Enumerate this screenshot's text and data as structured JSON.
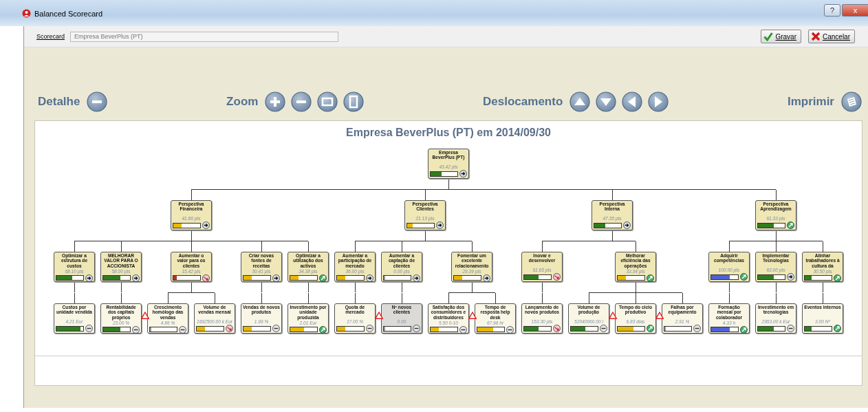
{
  "window": {
    "title": "Balanced Scorecard",
    "controls": [
      {
        "label": "?",
        "kind": "help"
      },
      {
        "label": "x",
        "kind": "close"
      }
    ]
  },
  "header": {
    "label": "Scorecard",
    "value": "Empresa BeverPlus (PT)",
    "actions": [
      {
        "label": "Gravar",
        "kind": "save"
      },
      {
        "label": "Cancelar",
        "kind": "cancel"
      }
    ]
  },
  "toolbar": [
    {
      "label": "Detalhe",
      "tools": [
        {
          "kind": "collapse"
        }
      ]
    },
    {
      "label": "Zoom",
      "tools": [
        {
          "kind": "zoom-in"
        },
        {
          "kind": "zoom-out"
        },
        {
          "kind": "fit-width"
        },
        {
          "kind": "fit-height"
        }
      ]
    },
    {
      "label": "Deslocamento",
      "tools": [
        {
          "kind": "up"
        },
        {
          "kind": "down"
        },
        {
          "kind": "left"
        },
        {
          "kind": "right"
        }
      ]
    },
    {
      "label": "Imprimir",
      "tools": [
        {
          "kind": "print"
        }
      ]
    }
  ],
  "map": {
    "title": "Empresa BeverPlus (PT) em 2014/09/30",
    "root": {
      "title": "Empresa BeverPlus (PT)",
      "value": "43.42 pts",
      "level": 0.4,
      "color": "#2f7d1e",
      "kind": "right",
      "warning": false,
      "disabled": false,
      "children": [
        {
          "title": "Perspectiva Financeira",
          "value": "41.86 pts",
          "level": 0.3,
          "color": "#e8b800",
          "kind": "right",
          "warning": false,
          "disabled": false,
          "children": [
            {
              "title": "Optimizar a estrutura de custos",
              "value": "68.10 pts",
              "level": 0.6,
              "color": "#2f7d1e",
              "kind": "right",
              "warning": false,
              "disabled": false,
              "children": [
                {
                  "title": "Custos por unidade vendida",
                  "value": "4.21 Eur",
                  "level": 0.9,
                  "color": "#2f7d1e",
                  "kind": "none",
                  "warning": false,
                  "disabled": false
                }
              ]
            },
            {
              "title": "MELHORAR VALOR PARA O ACCIONISTA",
              "value": "58.00 pts",
              "level": 0.65,
              "color": "#2f7d1e",
              "kind": "right",
              "warning": false,
              "disabled": false,
              "children": [
                {
                  "title": "Rentabilidade dos capitais próprios",
                  "value": "23.00 %",
                  "level": 0.65,
                  "color": "#2f7d1e",
                  "kind": "none",
                  "warning": false,
                  "disabled": false
                }
              ]
            },
            {
              "title": "Aumentar o valor para os clientes",
              "value": "15.42 pts",
              "level": 0.12,
              "color": "#b8341c",
              "kind": "down",
              "warning": false,
              "disabled": false,
              "children": [
                {
                  "title": "Crescimento homólogo das vendas",
                  "value": "4.86 %",
                  "level": 0,
                  "color": "#9a9a9a",
                  "kind": "none",
                  "warning": true,
                  "disabled": false
                },
                {
                  "title": "Volume de vendas mensal",
                  "value": "1692500.00 k Eur",
                  "level": 0.3,
                  "color": "#e8b800",
                  "kind": "down",
                  "warning": false,
                  "disabled": false
                }
              ]
            },
            {
              "title": "Criar novas fontes de receitas",
              "value": "30.41 pts",
              "level": 0.3,
              "color": "#e8b800",
              "kind": "right",
              "warning": false,
              "disabled": false,
              "children": [
                {
                  "title": "Vendas de novos produtos",
                  "value": "1.99 %",
                  "level": 0.3,
                  "color": "#e8b800",
                  "kind": "none",
                  "warning": false,
                  "disabled": false
                }
              ]
            },
            {
              "title": "Optimizar a utilização dos activos",
              "value": "34.38 pts",
              "level": 0.3,
              "color": "#e8b800",
              "kind": "up",
              "warning": false,
              "disabled": false,
              "children": [
                {
                  "title": "Investimento por unidade produzida",
                  "value": "2.01 Eur",
                  "level": 0.5,
                  "color": "#e8b800",
                  "kind": "up",
                  "warning": false,
                  "disabled": false
                }
              ]
            }
          ]
        },
        {
          "title": "Perspectiva Clientes",
          "value": "21.13 pts",
          "level": 0.2,
          "color": "#e8b800",
          "kind": "right",
          "warning": false,
          "disabled": false,
          "children": [
            {
              "title": "Aumentar a participação de mercado",
              "value": "36.00 pts",
              "level": 0.3,
              "color": "#e8b800",
              "kind": "right",
              "warning": false,
              "disabled": false,
              "children": [
                {
                  "title": "Quota de mercado",
                  "value": "17.00 %",
                  "level": 0.3,
                  "color": "#e8b800",
                  "kind": "none",
                  "warning": false,
                  "disabled": false
                }
              ]
            },
            {
              "title": "Aumentar a captação de clientes",
              "value": "0.00 pts",
              "level": 0,
              "color": "#9a9a9a",
              "kind": "right",
              "warning": false,
              "disabled": false,
              "children": [
                {
                  "title": "Nº novos clientes",
                  "value": "0.00",
                  "level": 0,
                  "color": "#9a9a9a",
                  "kind": "none",
                  "warning": true,
                  "disabled": true
                }
              ]
            },
            {
              "title": "Fomentar um excelente relacionamento",
              "value": "29.39 pts",
              "level": 0.3,
              "color": "#e8b800",
              "kind": "right",
              "warning": false,
              "disabled": false,
              "children": [
                {
                  "title": "Satisfação dos consumidores e distribuidores",
                  "value": "5.50 0-10",
                  "level": 0.3,
                  "color": "#e8b800",
                  "kind": "none",
                  "warning": false,
                  "disabled": false
                },
                {
                  "title": "Tempo de resposta help desk",
                  "value": "67.96 hr",
                  "level": 0.6,
                  "color": "#e8b800",
                  "kind": "none",
                  "warning": true,
                  "disabled": false
                }
              ]
            }
          ]
        },
        {
          "title": "Perspectiva Interna",
          "value": "47.35 pts",
          "level": 0.4,
          "color": "#2f7d1e",
          "kind": "right",
          "warning": false,
          "disabled": false,
          "children": [
            {
              "title": "Inovar e desenvolver",
              "value": "61.65 pts",
              "level": 0.55,
              "color": "#2f7d1e",
              "kind": "down",
              "warning": false,
              "disabled": false,
              "children": [
                {
                  "title": "Lançamento de novos produtos",
                  "value": "153.30 pts",
                  "level": 0.55,
                  "color": "#2f7d1e",
                  "kind": "down",
                  "warning": false,
                  "disabled": false
                }
              ]
            },
            {
              "title": "Melhorar eficiência das operações",
              "value": "33.34 pts",
              "level": 0.3,
              "color": "#e8b800",
              "kind": "up",
              "warning": false,
              "disabled": false,
              "children": [
                {
                  "title": "Volume de produção",
                  "value": "52040060.00 l",
                  "level": 0.55,
                  "color": "#2f7d1e",
                  "kind": "none",
                  "warning": false,
                  "disabled": false
                },
                {
                  "title": "Tempo do ciclo produtivo",
                  "value": "6.83 dias",
                  "level": 0.6,
                  "color": "#e8b800",
                  "kind": "up",
                  "warning": true,
                  "disabled": false
                },
                {
                  "title": "Falhas por equipamento",
                  "value": "2.91 %",
                  "level": 0,
                  "color": "#9a9a9a",
                  "kind": "none",
                  "warning": true,
                  "disabled": false
                }
              ]
            }
          ]
        },
        {
          "title": "Perspectiva Aprendizagem",
          "value": "61.33 pts",
          "level": 0.6,
          "color": "#2f7d1e",
          "kind": "up",
          "warning": false,
          "disabled": false,
          "children": [
            {
              "title": "Adquirir competências",
              "value": "100.00 pts",
              "level": 0.7,
              "color": "#5060d8",
              "kind": "up",
              "warning": false,
              "disabled": false,
              "children": [
                {
                  "title": "Formação mensal por colaborador",
                  "value": "4.33 h",
                  "level": 0.7,
                  "color": "#5060d8",
                  "kind": "up",
                  "warning": false,
                  "disabled": false
                }
              ]
            },
            {
              "title": "Implementar Tecnologias",
              "value": "63.00 pts",
              "level": 0.6,
              "color": "#2f7d1e",
              "kind": "right",
              "warning": false,
              "disabled": false,
              "children": [
                {
                  "title": "Investimento em tecnologias",
                  "value": "2953.00 k Eur",
                  "level": 0.6,
                  "color": "#2f7d1e",
                  "kind": "none",
                  "warning": false,
                  "disabled": false
                }
              ]
            },
            {
              "title": "Alinhar trabalhadores à cultura da",
              "value": "30.50 pts",
              "level": 0.25,
              "color": "#2f7d1e",
              "kind": "up",
              "warning": false,
              "disabled": false,
              "children": [
                {
                  "title": "Eventos internos",
                  "value": "3.00 Nº",
                  "level": 0.25,
                  "color": "#2f7d1e",
                  "kind": "up",
                  "warning": false,
                  "disabled": false
                }
              ]
            }
          ]
        }
      ]
    }
  }
}
